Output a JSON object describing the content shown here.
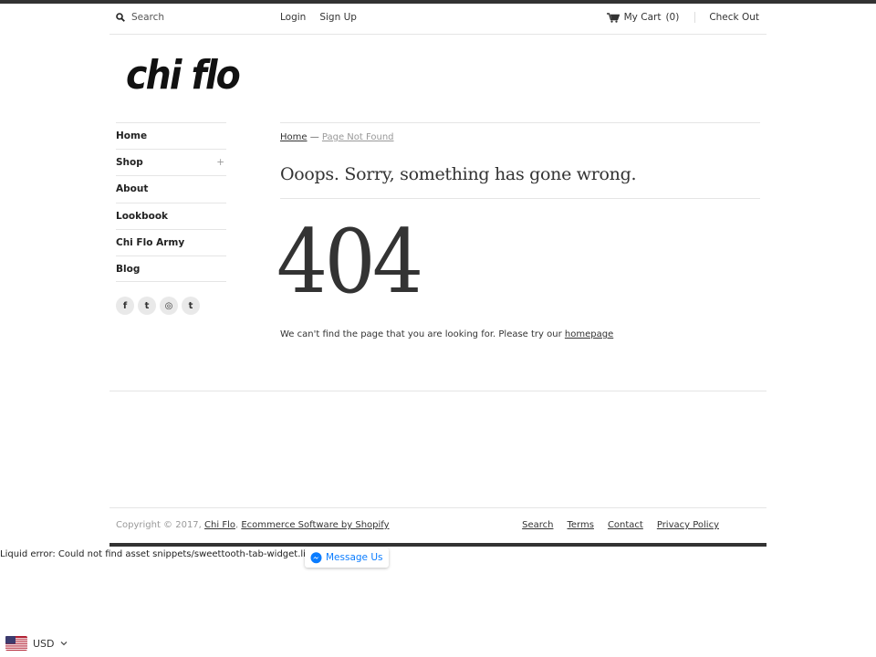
{
  "topnav": {
    "search_label": "Search",
    "login": "Login",
    "signup": "Sign Up",
    "cart_label": "My Cart",
    "cart_count": "(0)",
    "checkout": "Check Out"
  },
  "brand": {
    "logo_text": "chi flo"
  },
  "sidebar": {
    "items": [
      {
        "label": "Home"
      },
      {
        "label": "Shop",
        "expand": "+"
      },
      {
        "label": "About"
      },
      {
        "label": "Lookbook"
      },
      {
        "label": "Chi Flo Army"
      },
      {
        "label": "Blog"
      }
    ],
    "social": [
      {
        "icon": "facebook-icon",
        "glyph": "f"
      },
      {
        "icon": "twitter-icon",
        "glyph": "t"
      },
      {
        "icon": "instagram-icon",
        "glyph": "◎"
      },
      {
        "icon": "tumblr-icon",
        "glyph": "t"
      }
    ]
  },
  "main": {
    "breadcrumb_home": "Home",
    "breadcrumb_sep": "—",
    "breadcrumb_current": "Page Not Found",
    "heading": "Ooops. Sorry, something has gone wrong.",
    "error_code": "404",
    "message": "We can't find the page that you are looking for. Please try our",
    "message_link": "homepage"
  },
  "footer": {
    "copyright": "Copyright © 2017,",
    "shop_name": "Chi Flo",
    "comma": ",",
    "powered": "Ecommerce Software by Shopify",
    "links": [
      "Search",
      "Terms",
      "Contact",
      "Privacy Policy"
    ]
  },
  "error_text": "Liquid error: Could not find asset snippets/sweettooth-tab-widget.liquid",
  "messenger": {
    "label": "Message Us"
  },
  "currency": {
    "code": "USD"
  },
  "colors": {
    "text": "#333333",
    "rule": "#e5e5e5",
    "muted": "#999999",
    "messenger": "#0a7cff"
  }
}
